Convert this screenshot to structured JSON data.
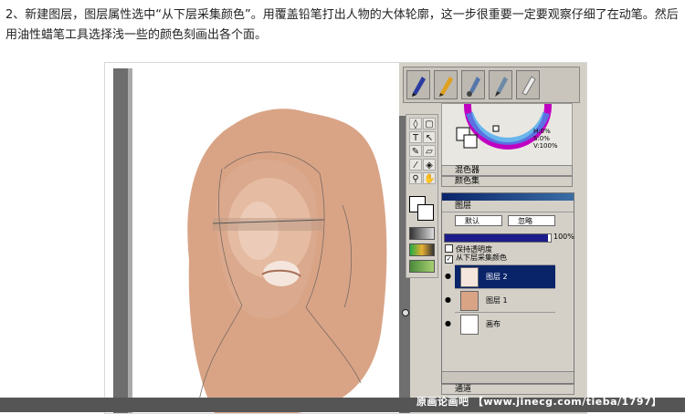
{
  "caption": "2、新建图层，图层属性选中“从下层采集颜色”。用覆盖铅笔打出人物的大体轮廓，这一步很重要一定要观察仔细了在动笔。然后用油性蜡笔工具选择浅一些的颜色刻画出各个面。",
  "brushes": [
    "pen-icon",
    "pencil-icon",
    "airbrush-icon",
    "brush-icon",
    "eraser-icon"
  ],
  "color_readout": {
    "h": "H:0%",
    "s": "S:0%",
    "v": "V:100%"
  },
  "panels": {
    "mixer": "混色器",
    "color_set": "颜色集",
    "channels": "通道"
  },
  "layers_panel": {
    "title": "图层",
    "blend_mode": "默认",
    "second_select": "忽略",
    "opacity": "100%",
    "preserve_transparency": "保持透明度",
    "sample_lower": "从下层采集颜色",
    "layers": [
      {
        "name": "图层 2",
        "active": true
      },
      {
        "name": "图层 1",
        "active": false
      },
      {
        "name": "画布",
        "active": false
      }
    ]
  },
  "watermark": "原画论画吧 【www.jinecg.com/tieba/1797】",
  "colors": {
    "skin": "#d9a486",
    "panel": "#d4d0c8",
    "highlight": "#0a246a"
  }
}
